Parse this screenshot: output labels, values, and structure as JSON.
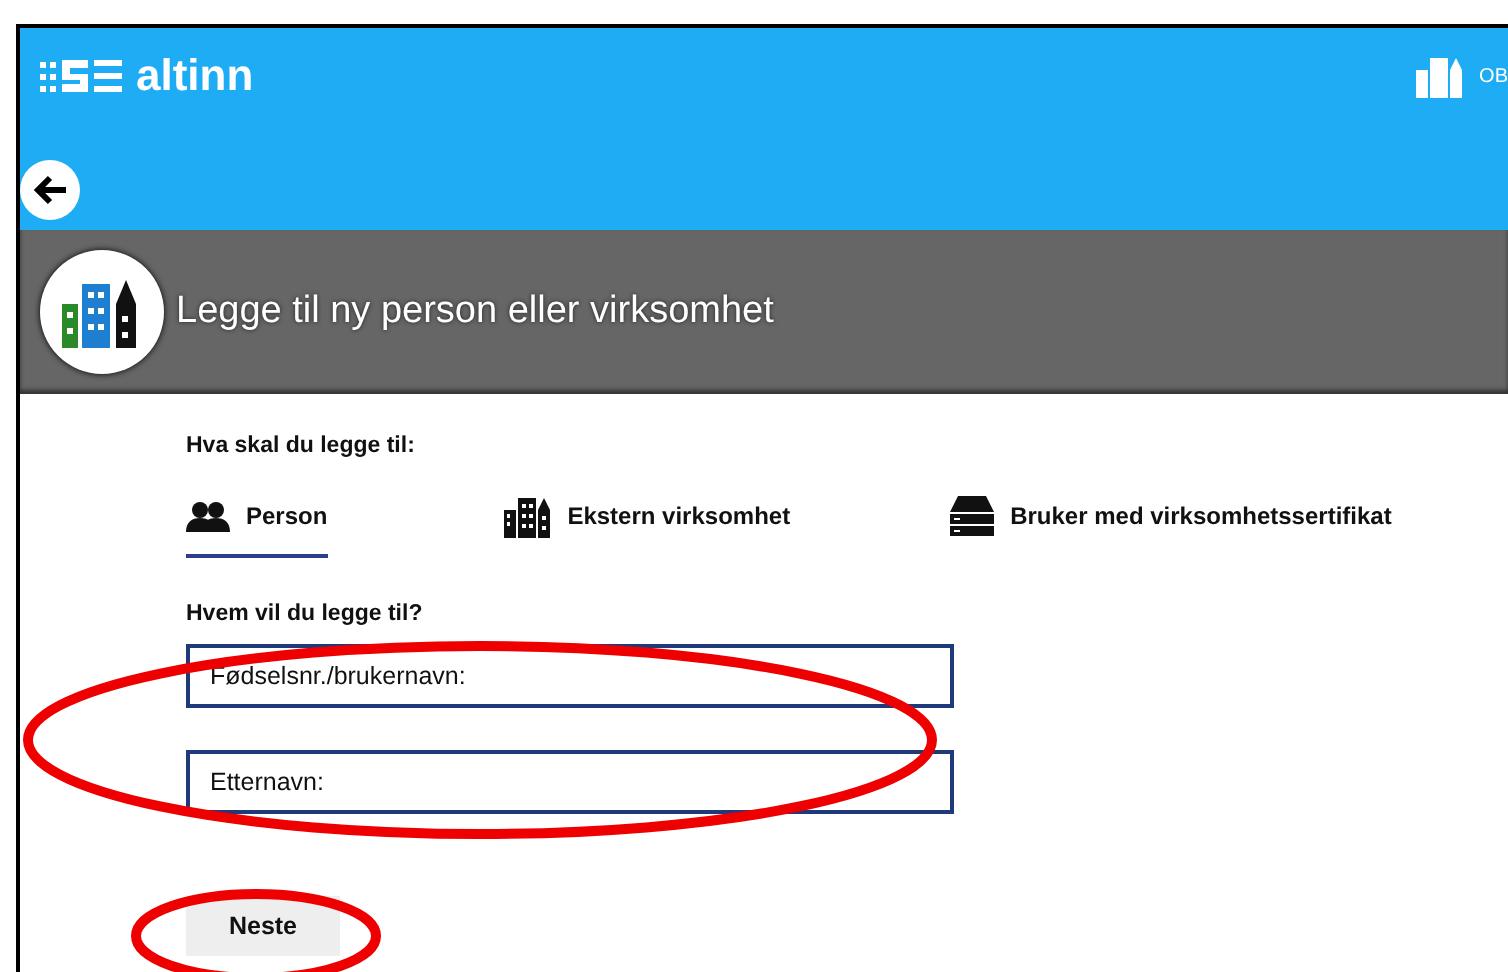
{
  "header": {
    "logo_text": "altinn",
    "account_text": "OB"
  },
  "page_title": "Legge til ny person eller virksomhet",
  "question_1": "Hva skal du legge til:",
  "tabs": [
    {
      "label": "Person",
      "kind": "person",
      "selected": true
    },
    {
      "label": "Ekstern virksomhet",
      "kind": "building",
      "selected": false
    },
    {
      "label": "Bruker med virksomhetssertifikat",
      "kind": "server",
      "selected": false
    }
  ],
  "question_2": "Hvem vil du legge til?",
  "fields": [
    {
      "placeholder": "Fødselsnr./brukernavn:"
    },
    {
      "placeholder": "Etternavn:"
    }
  ],
  "button": "Neste"
}
